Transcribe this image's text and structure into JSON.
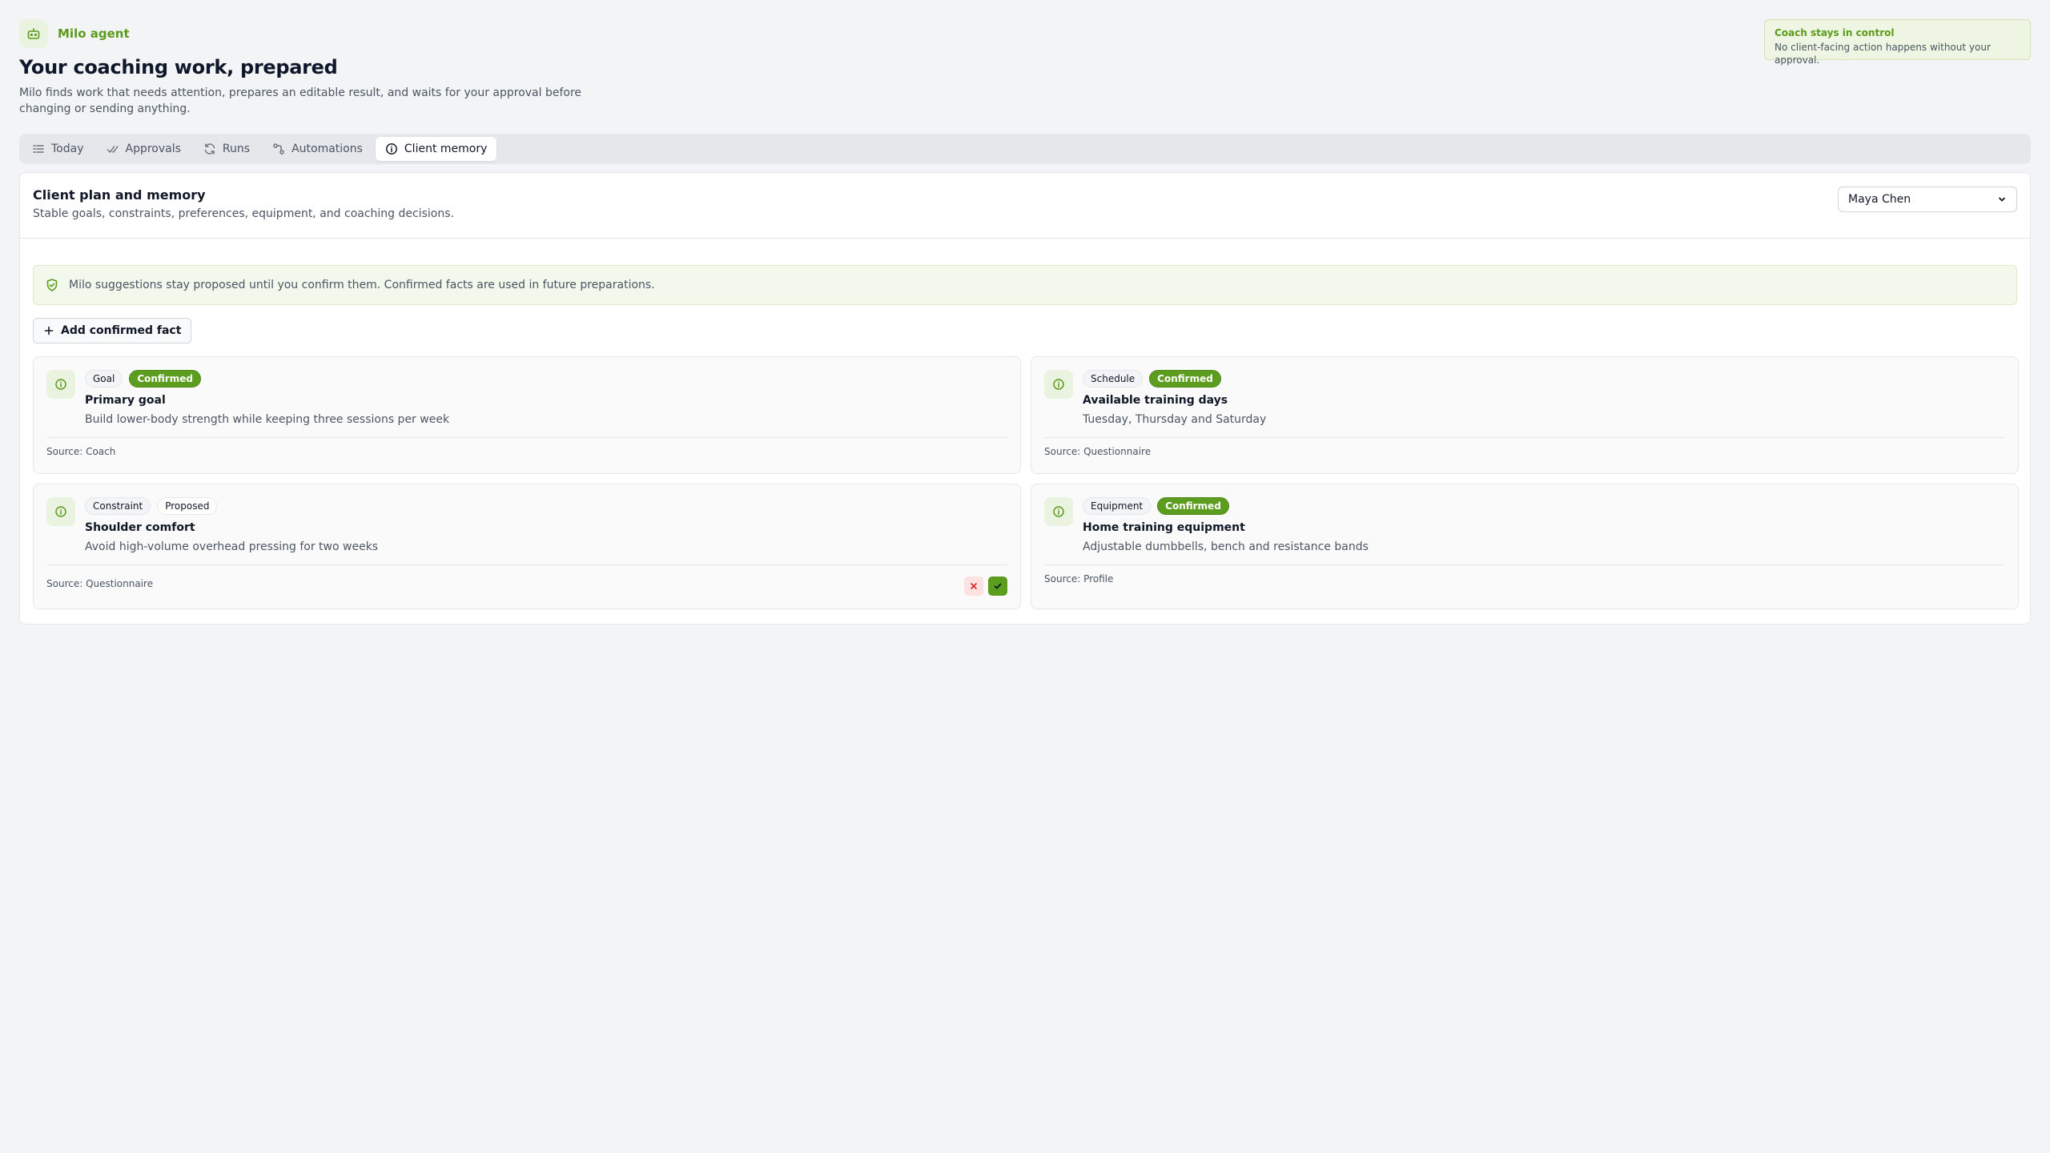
{
  "header": {
    "brand_name": "Milo agent",
    "title": "Your coaching work, prepared",
    "subtitle": "Milo finds work that needs attention, prepares an editable result, and waits for your approval before changing or sending anything."
  },
  "control_notice": {
    "title": "Coach stays in control",
    "text": "No client-facing action happens without your approval."
  },
  "tabs": [
    {
      "label": "Today",
      "icon": "list-icon",
      "active": false
    },
    {
      "label": "Approvals",
      "icon": "check-double-icon",
      "active": false
    },
    {
      "label": "Runs",
      "icon": "refresh-icon",
      "active": false
    },
    {
      "label": "Automations",
      "icon": "workflow-icon",
      "active": false
    },
    {
      "label": "Client memory",
      "icon": "info-icon",
      "active": true
    }
  ],
  "panel": {
    "title": "Client plan and memory",
    "subtitle": "Stable goals, constraints, preferences, equipment, and coaching decisions.",
    "client_select": "Maya Chen",
    "notice": "Milo suggestions stay proposed until you confirm them. Confirmed facts are used in future preparations.",
    "add_button": "Add confirmed fact"
  },
  "facts": [
    {
      "category": "Goal",
      "status": "Confirmed",
      "title": "Primary goal",
      "text": "Build lower-body strength while keeping three sessions per week",
      "source": "Source: Coach"
    },
    {
      "category": "Schedule",
      "status": "Confirmed",
      "title": "Available training days",
      "text": "Tuesday, Thursday and Saturday",
      "source": "Source: Questionnaire"
    },
    {
      "category": "Constraint",
      "status": "Proposed",
      "title": "Shoulder comfort",
      "text": "Avoid high-volume overhead pressing for two weeks",
      "source": "Source: Questionnaire"
    },
    {
      "category": "Equipment",
      "status": "Confirmed",
      "title": "Home training equipment",
      "text": "Adjustable dumbbells, bench and resistance bands",
      "source": "Source: Profile"
    }
  ],
  "colors": {
    "accent": "#5c9d1f",
    "accent_light": "#eaf3e0",
    "reject_bg": "#fde2e2",
    "reject_icon": "#dc2626"
  }
}
